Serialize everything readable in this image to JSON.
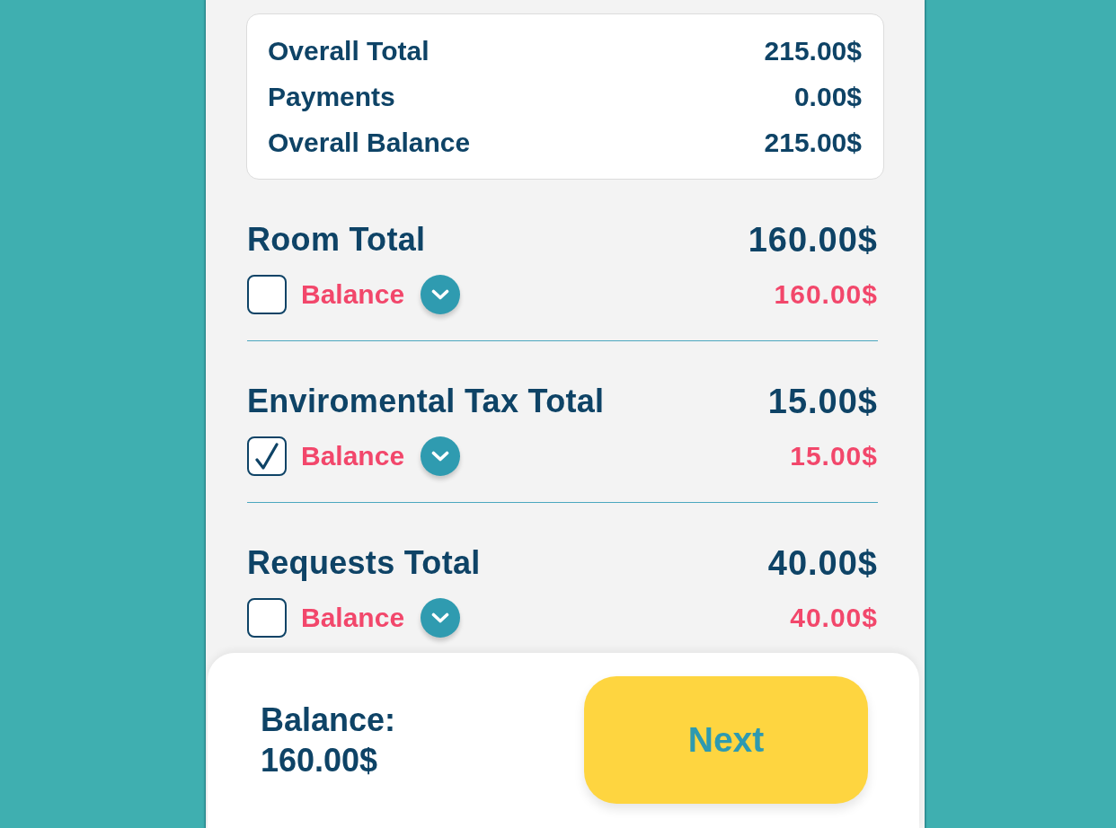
{
  "summary": [
    {
      "label": "Overall Total",
      "value": "215.00$"
    },
    {
      "label": "Payments",
      "value": "0.00$"
    },
    {
      "label": "Overall Balance",
      "value": "215.00$"
    }
  ],
  "sections": [
    {
      "title": "Room Total",
      "total": "160.00$",
      "checked": false,
      "balance_label": "Balance",
      "balance": "160.00$"
    },
    {
      "title": "Enviromental Tax Total",
      "total": "15.00$",
      "checked": true,
      "balance_label": "Balance",
      "balance": "15.00$"
    },
    {
      "title": "Requests Total",
      "total": "40.00$",
      "checked": false,
      "balance_label": "Balance",
      "balance": "40.00$"
    }
  ],
  "footer": {
    "balance_label": "Balance:",
    "balance": "160.00$",
    "button": "Next"
  }
}
